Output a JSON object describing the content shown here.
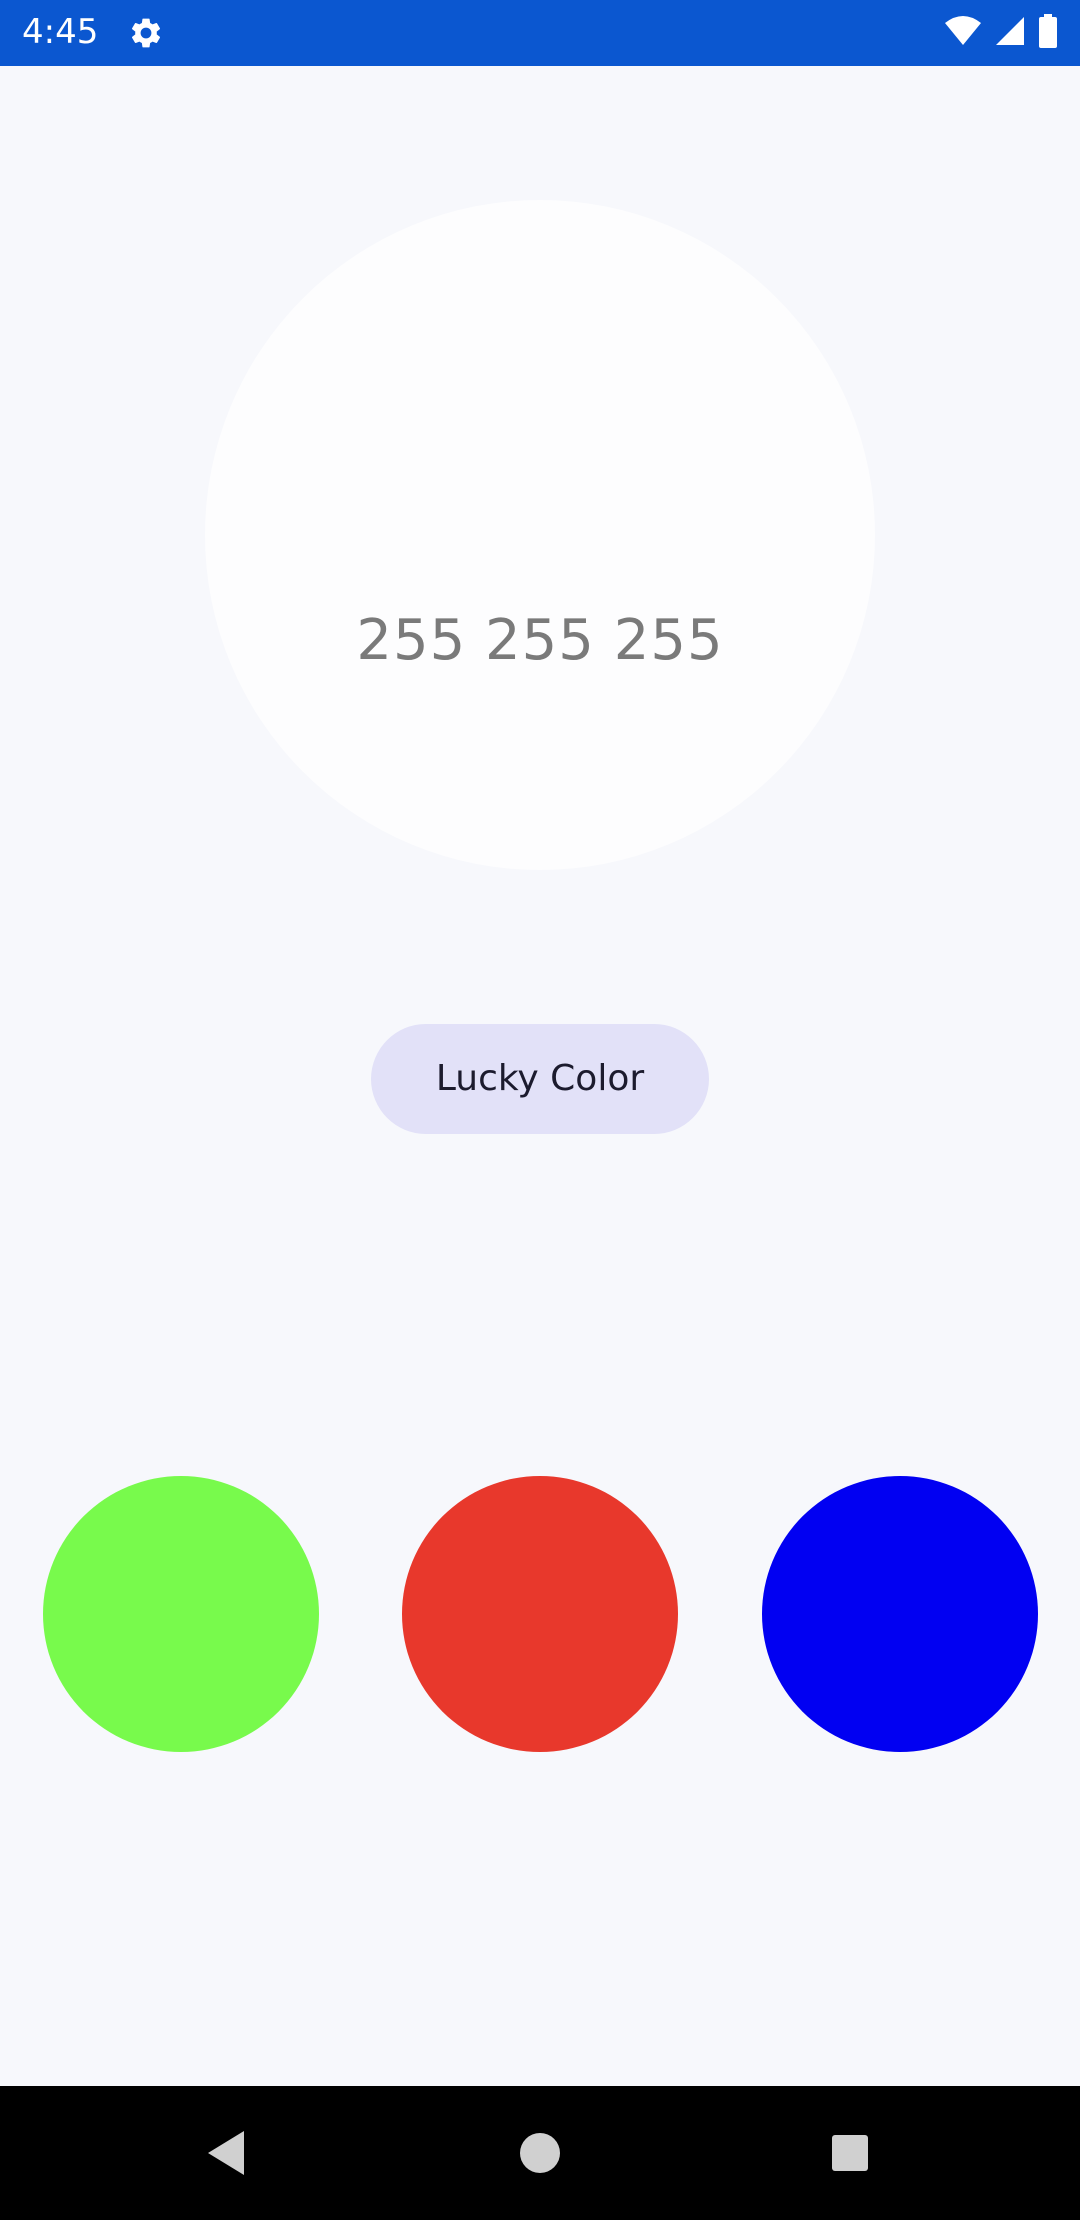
{
  "status_bar": {
    "time": "4:45",
    "background": "#0b57d0",
    "icons": [
      "settings-icon",
      "wifi-icon",
      "cell-signal-icon",
      "battery-icon"
    ]
  },
  "main": {
    "rgb_text": "255 255 255",
    "current_color": "#ffffff",
    "lucky_button_label": "Lucky Color",
    "color_dots": [
      {
        "name": "green",
        "color": "#78fa4c"
      },
      {
        "name": "red",
        "color": "#e8382c"
      },
      {
        "name": "blue",
        "color": "#0100f2"
      }
    ]
  },
  "nav_bar": {
    "icons": [
      "back-icon",
      "home-icon",
      "recents-icon"
    ]
  }
}
